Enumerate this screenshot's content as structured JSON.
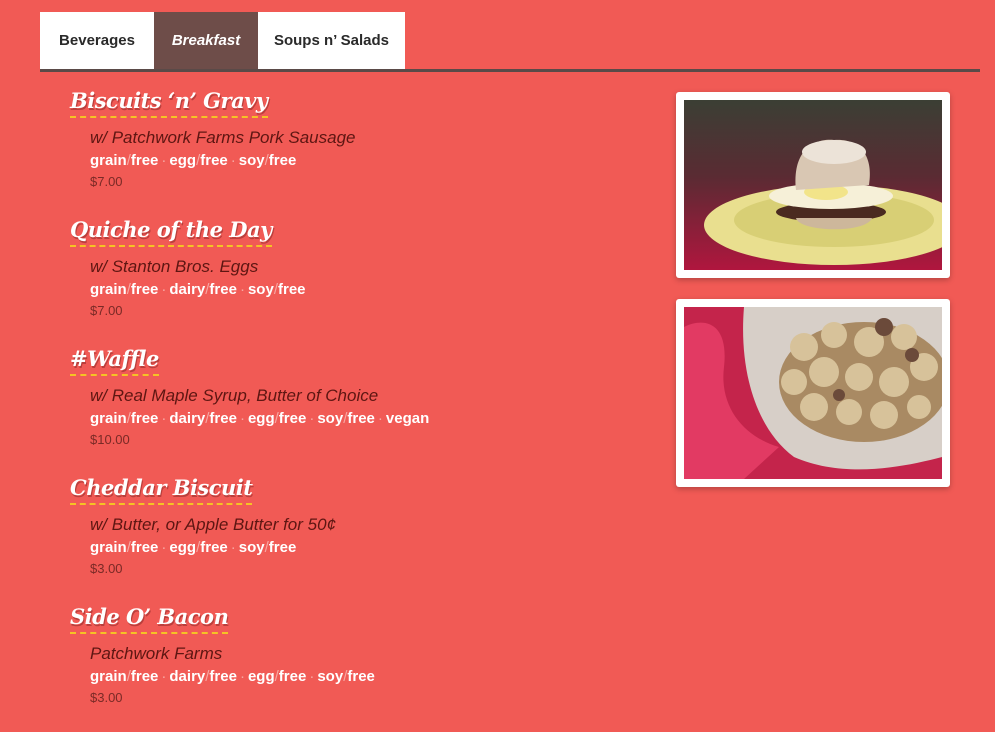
{
  "tabs": [
    {
      "label": "Beverages",
      "active": false
    },
    {
      "label": "Breakfast",
      "active": true
    },
    {
      "label": "Soups n’ Salads",
      "active": false
    }
  ],
  "menu": [
    {
      "title": "Biscuits ‘n’ Gravy",
      "desc": "w/ Patchwork Farms Pork Sausage",
      "price": "$7.00",
      "tags": [
        [
          "grain",
          "free"
        ],
        [
          "egg",
          "free"
        ],
        [
          "soy",
          "free"
        ]
      ]
    },
    {
      "title": "Quiche of the Day",
      "desc": "w/ Stanton Bros. Eggs",
      "price": "$7.00",
      "tags": [
        [
          "grain",
          "free"
        ],
        [
          "dairy",
          "free"
        ],
        [
          "soy",
          "free"
        ]
      ]
    },
    {
      "title": "#Waffle",
      "desc": "w/ Real Maple Syrup, Butter of Choice",
      "price": "$10.00",
      "tags": [
        [
          "grain",
          "free"
        ],
        [
          "dairy",
          "free"
        ],
        [
          "egg",
          "free"
        ],
        [
          "soy",
          "free"
        ],
        [
          "vegan",
          ""
        ]
      ]
    },
    {
      "title": "Cheddar Biscuit",
      "desc": "w/ Butter, or Apple Butter for 50¢",
      "price": "$3.00",
      "tags": [
        [
          "grain",
          "free"
        ],
        [
          "egg",
          "free"
        ],
        [
          "soy",
          "free"
        ]
      ]
    },
    {
      "title": "Side O’ Bacon",
      "desc": "Patchwork Farms",
      "price": "$3.00",
      "tags": [
        [
          "grain",
          "free"
        ],
        [
          "dairy",
          "free"
        ],
        [
          "egg",
          "free"
        ],
        [
          "soy",
          "free"
        ]
      ]
    }
  ],
  "colors": {
    "background": "#f15a55",
    "active_tab": "#6e4d49",
    "title_underline": "#f5c325"
  }
}
